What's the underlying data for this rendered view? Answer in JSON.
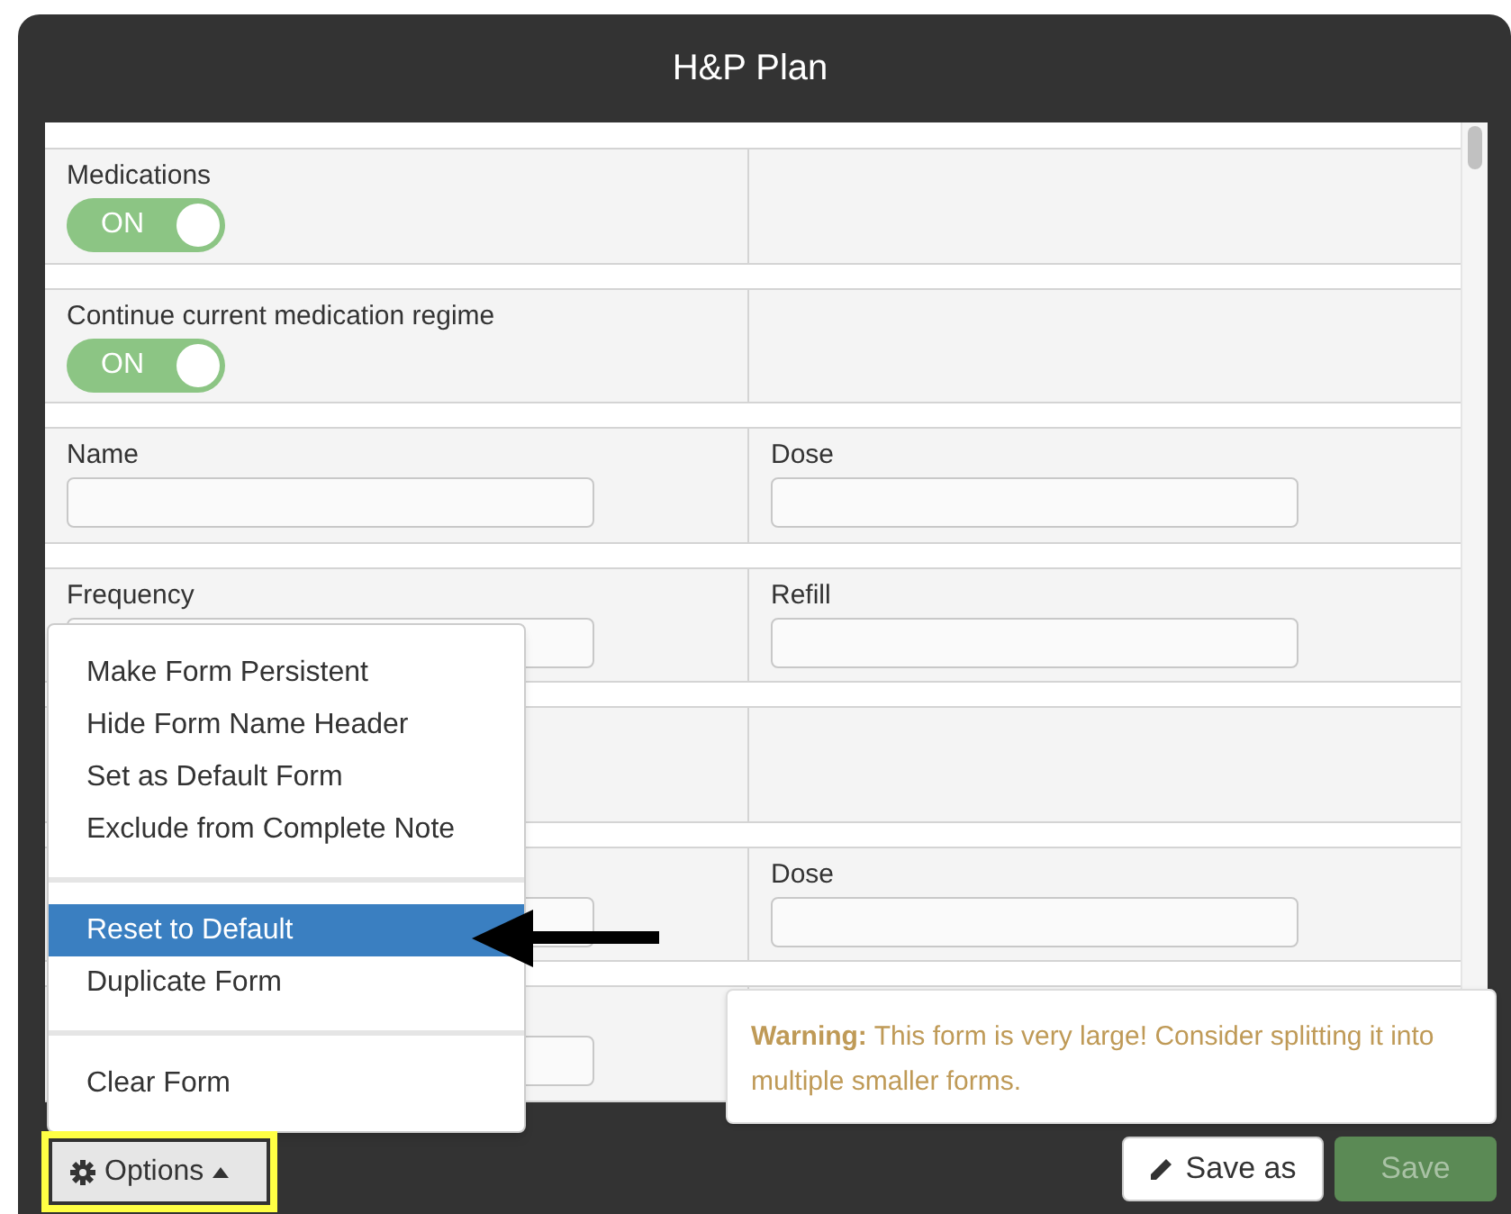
{
  "window": {
    "title": "H&P Plan"
  },
  "rows": [
    {
      "cells": [
        {
          "kind": "toggle",
          "label": "Medications",
          "on": true,
          "text": "ON"
        },
        {
          "kind": "blank"
        }
      ]
    },
    {
      "cells": [
        {
          "kind": "toggle",
          "label": "Continue current medication regime",
          "on": true,
          "text": "ON"
        },
        {
          "kind": "blank"
        }
      ]
    },
    {
      "cells": [
        {
          "kind": "field",
          "label": "Name"
        },
        {
          "kind": "field",
          "label": "Dose"
        }
      ]
    },
    {
      "cells": [
        {
          "kind": "field",
          "label": "Frequency"
        },
        {
          "kind": "field",
          "label": "Refill"
        }
      ]
    },
    {
      "cells": [
        {
          "kind": "blank"
        },
        {
          "kind": "blank"
        }
      ]
    },
    {
      "cells": [
        {
          "kind": "field"
        },
        {
          "kind": "field",
          "label": "Dose"
        }
      ]
    },
    {
      "cells": [
        {
          "kind": "field"
        },
        {
          "kind": "blank"
        }
      ]
    }
  ],
  "menu": {
    "items": [
      {
        "kind": "item",
        "label": "Make Form Persistent",
        "selected": false
      },
      {
        "kind": "item",
        "label": "Hide Form Name Header",
        "selected": false
      },
      {
        "kind": "item",
        "label": "Set as Default Form",
        "selected": false
      },
      {
        "kind": "item",
        "label": "Exclude from Complete Note",
        "selected": false
      },
      {
        "kind": "divider"
      },
      {
        "kind": "item",
        "label": "Reset to Default",
        "selected": true
      },
      {
        "kind": "item",
        "label": "Duplicate Form",
        "selected": false
      },
      {
        "kind": "divider"
      },
      {
        "kind": "item",
        "label": "Clear Form",
        "selected": false
      }
    ]
  },
  "warning": {
    "text": "**Warning:** This form is very large! Consider splitting it into multiple smaller forms."
  },
  "footer": {
    "options": "Options",
    "save_as": "Save as",
    "save": {
      "label": "Save",
      "disabled": true
    }
  }
}
